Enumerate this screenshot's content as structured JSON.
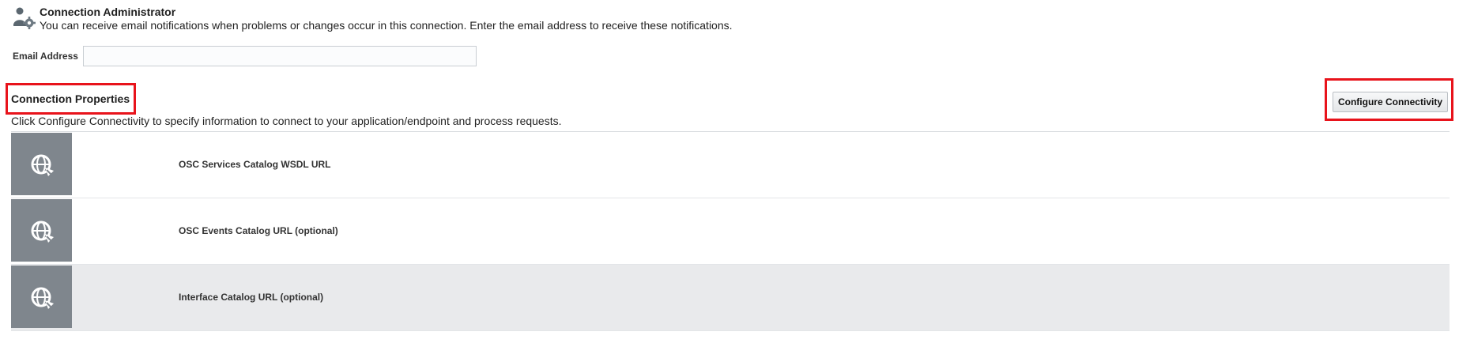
{
  "admin": {
    "title": "Connection Administrator",
    "description": "You can receive email notifications when problems or changes occur in this connection. Enter the email address to receive these notifications.",
    "icon": "user-gear-icon"
  },
  "email": {
    "label": "Email Address",
    "value": "",
    "placeholder": ""
  },
  "properties": {
    "title": "Connection Properties",
    "description": "Click Configure Connectivity to specify information to connect to your application/endpoint and process requests.",
    "configure_button": "Configure Connectivity",
    "rows": [
      {
        "label": "OSC Services Catalog WSDL URL",
        "icon": "globe-refresh-icon"
      },
      {
        "label": "OSC Events Catalog URL (optional)",
        "icon": "globe-refresh-icon"
      },
      {
        "label": "Interface Catalog URL (optional)",
        "icon": "globe-refresh-icon"
      }
    ]
  },
  "colors": {
    "highlight_red": "#e8131b",
    "icon_tile": "#7f868d",
    "shaded_row": "#e9eaec"
  }
}
